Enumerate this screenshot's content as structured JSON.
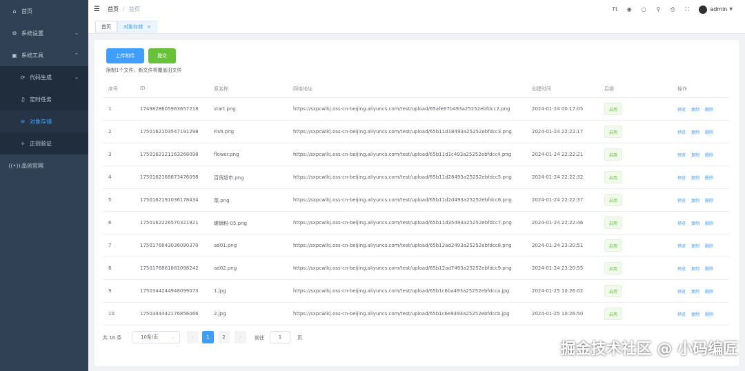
{
  "sidebar": {
    "items": [
      {
        "label": "首页",
        "icon": "home-icon"
      },
      {
        "label": "系统设置",
        "icon": "gear-icon"
      },
      {
        "label": "系统工具",
        "icon": "tools-icon"
      },
      {
        "label": "代码生成",
        "icon": "code-icon"
      },
      {
        "label": "定时任务",
        "icon": "bell-icon"
      },
      {
        "label": "对象存储",
        "icon": "storage-icon"
      },
      {
        "label": "正则验证",
        "icon": "regex-icon"
      },
      {
        "label": "品创官网",
        "icon": "broadcast-icon"
      }
    ]
  },
  "header": {
    "breadcrumb": [
      "首页",
      "首页"
    ],
    "username": "admin",
    "icons": [
      "translate-icon",
      "github-icon",
      "theme-icon",
      "shirt-icon",
      "lock-icon",
      "fullscreen-icon"
    ]
  },
  "tags": [
    {
      "label": "首页"
    },
    {
      "label": "对象存储"
    }
  ],
  "upload": {
    "upload_label": "上传附件",
    "submit_label": "提交",
    "tip": "限制1个文件，新文件将覆盖旧文件"
  },
  "table": {
    "headers": [
      "序号",
      "ID",
      "原名称",
      "网络地址",
      "创建时间",
      "后缀",
      "操作"
    ],
    "status_label": "启用",
    "actions": [
      "预览",
      "复制",
      "删除"
    ],
    "rows": [
      {
        "no": "1",
        "id": "1749828605963657218",
        "name": "start.png",
        "url": "https://sxpcwlkj.oss-cn-beijing.aliyuncs.com/test/upload/65afe67b493a25252ebfdcc2.png",
        "time": "2024-01-24 00:17:05"
      },
      {
        "no": "2",
        "id": "1750162103547191298",
        "name": "Fish.png",
        "url": "https://sxpcwlkj.oss-cn-beijing.aliyuncs.com/test/upload/65b11d18493a25252ebfdcc3.png",
        "time": "2024-01-24 22:22:17"
      },
      {
        "no": "3",
        "id": "1750162121163268098",
        "name": "flower.png",
        "url": "https://sxpcwlkj.oss-cn-beijing.aliyuncs.com/test/upload/65b11d1c493a25252ebfdcc4.png",
        "time": "2024-01-24 22:22:21"
      },
      {
        "no": "4",
        "id": "1750162168873476098",
        "name": "百货超市.png",
        "url": "https://sxpcwlkj.oss-cn-beijing.aliyuncs.com/test/upload/65b11d28493a25252ebfdcc5.png",
        "time": "2024-01-24 22:22:32"
      },
      {
        "no": "5",
        "id": "1750162191036178434",
        "name": "菜.png",
        "url": "https://sxpcwlkj.oss-cn-beijing.aliyuncs.com/test/upload/65b11d2d493a25252ebfdcc6.png",
        "time": "2024-01-24 22:22:37"
      },
      {
        "no": "6",
        "id": "1750162226570321921",
        "name": "螺蛳粉-05.png",
        "url": "https://sxpcwlkj.oss-cn-beijing.aliyuncs.com/test/upload/65b11d35493a25252ebfdcc7.png",
        "time": "2024-01-24 22:22:46"
      },
      {
        "no": "7",
        "id": "1750176843036090370",
        "name": "ad01.png",
        "url": "https://sxpcwlkj.oss-cn-beijing.aliyuncs.com/test/upload/65b12ad2493a25252ebfdcc8.png",
        "time": "2024-01-24 23:20:51"
      },
      {
        "no": "8",
        "id": "1750176861881098242",
        "name": "ad02.png",
        "url": "https://sxpcwlkj.oss-cn-beijing.aliyuncs.com/test/upload/65b12ad7493a25252ebfdcc9.png",
        "time": "2024-01-24 23:20:55"
      },
      {
        "no": "9",
        "id": "1750344244948099073",
        "name": "1.jpg",
        "url": "https://sxpcwlkj.oss-cn-beijing.aliyuncs.com/test/upload/65b1c6ba493a25252ebfdcca.jpg",
        "time": "2024-01-25 10:26:02"
      },
      {
        "no": "10",
        "id": "1750344442176856066",
        "name": "2.jpg",
        "url": "https://sxpcwlkj.oss-cn-beijing.aliyuncs.com/test/upload/65b1c6e9493a25252ebfdccb.jpg",
        "time": "2024-01-25 10:26:50"
      }
    ]
  },
  "pagination": {
    "total": "共 16 条",
    "page_size": "10条/页",
    "pages": [
      "1",
      "2"
    ],
    "current": "1",
    "goto_label": "前往",
    "goto_value": "1",
    "page_suffix": "页"
  },
  "watermark": "掘金技术社区 @ 小码编匠",
  "colors": {
    "primary": "#409eff",
    "success": "#67c23a",
    "sidebar": "#304156"
  }
}
